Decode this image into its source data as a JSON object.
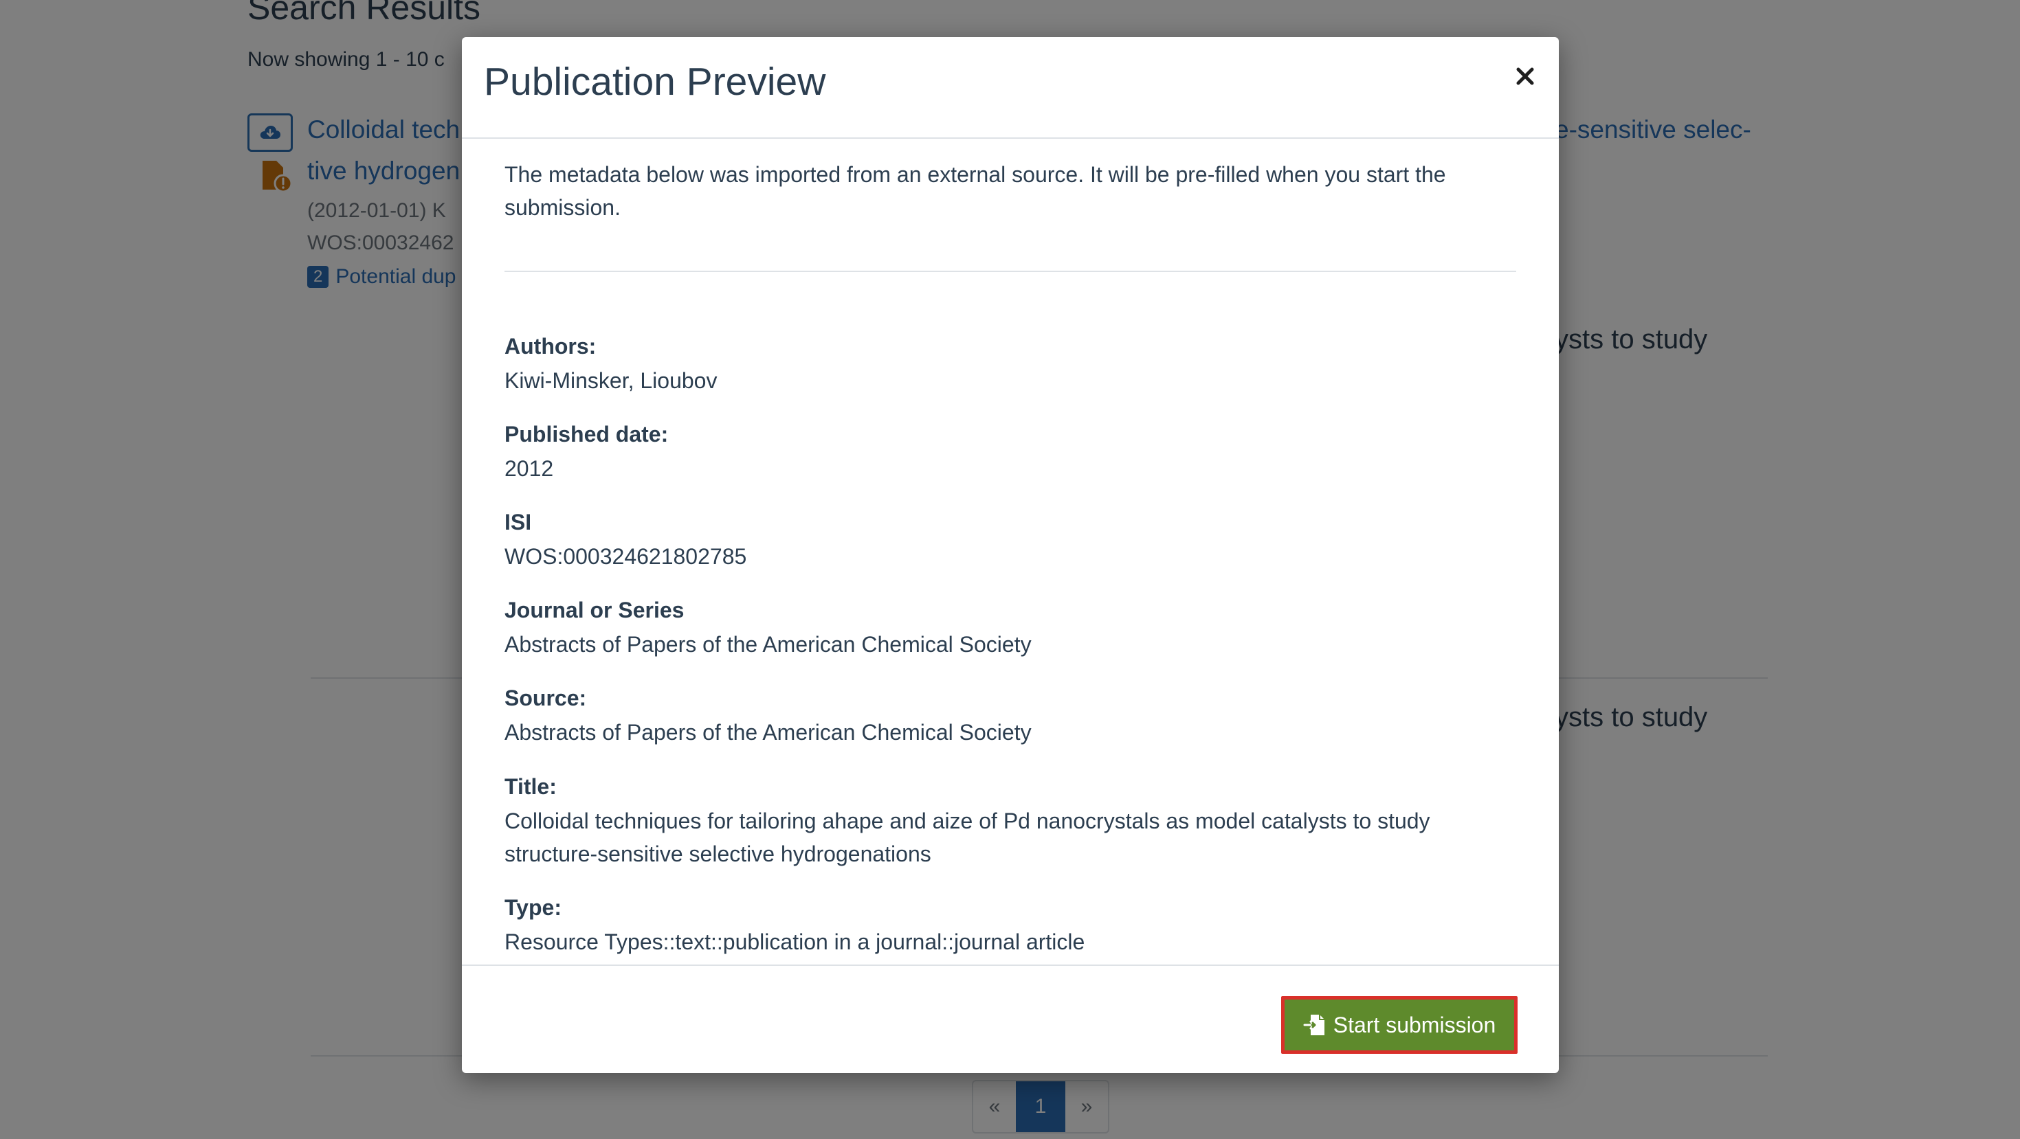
{
  "background": {
    "page_title": "Search Results",
    "showing_text": "Now showing 1 - 10 c",
    "result_title_line1": "Colloidal tech",
    "result_title_line2": "tive hydrogen",
    "result_title_right": "e-sensitive selec-",
    "result_date": "(2012-01-01) K",
    "result_wos": "WOS:00032462",
    "duplicate_count": "2",
    "duplicate_text": "Potential dup",
    "right_text_2": "ysts to study",
    "right_text_3": "ysts to study",
    "pagination": {
      "prev": "«",
      "current": "1",
      "next": "»"
    }
  },
  "modal": {
    "title": "Publication Preview",
    "close_symbol": "×",
    "intro": "The metadata below was imported from an external source. It will be pre-filled when you start the submission.",
    "fields": [
      {
        "label": "Authors:",
        "value": "Kiwi-Minsker, Lioubov"
      },
      {
        "label": "Published date:",
        "value": "2012"
      },
      {
        "label": "ISI",
        "value": "WOS:000324621802785"
      },
      {
        "label": "Journal or Series",
        "value": "Abstracts of Papers of the American Chemical Society"
      },
      {
        "label": "Source:",
        "value": "Abstracts of Papers of the American Chemical Society"
      },
      {
        "label": "Title:",
        "value": "Colloidal techniques for tailoring ahape and aize of Pd nanocrystals as model catalysts to study structure-sensitive selective hydrogenations"
      },
      {
        "label": "Type:",
        "value": "Resource Types::text::publication in a journal::journal article"
      }
    ],
    "start_button_label": "Start submission"
  },
  "colors": {
    "primary_blue": "#2a6db5",
    "button_green": "#5e8a2c",
    "highlight_red": "#d9302a",
    "text_dark": "#2c3e50",
    "warning_orange": "#c8720f"
  },
  "icons": {
    "download": "cloud-download-icon",
    "file_warning": "file-warning-icon",
    "submit": "file-import-icon",
    "close": "close-icon"
  }
}
